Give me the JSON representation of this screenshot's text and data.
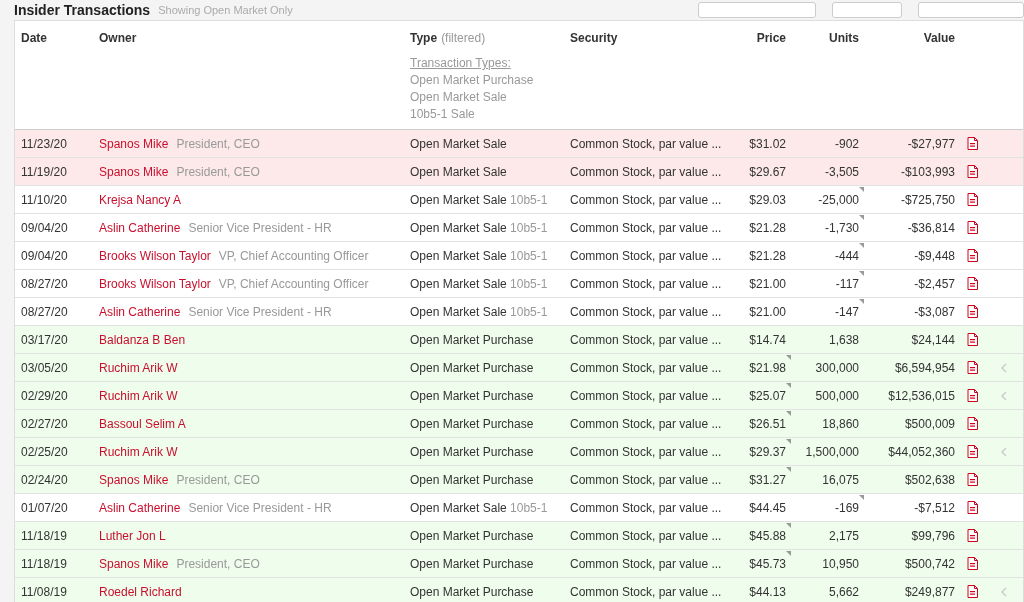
{
  "page": {
    "title": "Insider Transactions",
    "subtitle": "Showing Open Market Only"
  },
  "table": {
    "columns": [
      {
        "label": "Date"
      },
      {
        "label": "Owner"
      },
      {
        "label": "Type",
        "note": "(filtered)"
      },
      {
        "label": "Security"
      },
      {
        "label": "Price"
      },
      {
        "label": "Units"
      },
      {
        "label": "Value"
      }
    ],
    "filter": {
      "heading": "Transaction Types:",
      "options": [
        "Open Market Purchase",
        "Open Market Sale",
        "10b5-1 Sale"
      ]
    },
    "rows": [
      {
        "kind": "sale",
        "date": "11/23/20",
        "owner": "Spanos Mike",
        "role": "President, CEO",
        "type": "Open Market Sale",
        "security": "Common Stock, par value ...",
        "price": "$31.02",
        "units": "-902",
        "value": "-$27,977",
        "price_flag": false,
        "units_flag": false,
        "expander": false
      },
      {
        "kind": "sale",
        "date": "11/19/20",
        "owner": "Spanos Mike",
        "role": "President, CEO",
        "type": "Open Market Sale",
        "security": "Common Stock, par value ...",
        "price": "$29.67",
        "units": "-3,505",
        "value": "-$103,993",
        "price_flag": false,
        "units_flag": false,
        "expander": false
      },
      {
        "kind": "plan",
        "date": "11/10/20",
        "owner": "Krejsa Nancy A",
        "type": "Open Market Sale",
        "type_note": "10b5-1",
        "security": "Common Stock, par value ...",
        "price": "$29.03",
        "units": "-25,000",
        "value": "-$725,750",
        "price_flag": false,
        "units_flag": true,
        "expander": false
      },
      {
        "kind": "plan",
        "date": "09/04/20",
        "owner": "Aslin Catherine",
        "role": "Senior Vice President - HR",
        "type": "Open Market Sale",
        "type_note": "10b5-1",
        "security": "Common Stock, par value ...",
        "price": "$21.28",
        "units": "-1,730",
        "value": "-$36,814",
        "price_flag": false,
        "units_flag": true,
        "expander": false
      },
      {
        "kind": "plan",
        "date": "09/04/20",
        "owner": "Brooks Wilson Taylor",
        "role": "VP, Chief Accounting Officer",
        "type": "Open Market Sale",
        "type_note": "10b5-1",
        "security": "Common Stock, par value ...",
        "price": "$21.28",
        "units": "-444",
        "value": "-$9,448",
        "price_flag": false,
        "units_flag": true,
        "expander": false
      },
      {
        "kind": "plan",
        "date": "08/27/20",
        "owner": "Brooks Wilson Taylor",
        "role": "VP, Chief Accounting Officer",
        "type": "Open Market Sale",
        "type_note": "10b5-1",
        "security": "Common Stock, par value ...",
        "price": "$21.00",
        "units": "-117",
        "value": "-$2,457",
        "price_flag": false,
        "units_flag": true,
        "expander": false
      },
      {
        "kind": "plan",
        "date": "08/27/20",
        "owner": "Aslin Catherine",
        "role": "Senior Vice President - HR",
        "type": "Open Market Sale",
        "type_note": "10b5-1",
        "security": "Common Stock, par value ...",
        "price": "$21.00",
        "units": "-147",
        "value": "-$3,087",
        "price_flag": false,
        "units_flag": true,
        "expander": false
      },
      {
        "kind": "purchase",
        "date": "03/17/20",
        "owner": "Baldanza B Ben",
        "type": "Open Market Purchase",
        "security": "Common Stock, par value ...",
        "price": "$14.74",
        "units": "1,638",
        "value": "$24,144",
        "price_flag": false,
        "units_flag": false,
        "expander": false
      },
      {
        "kind": "purchase",
        "date": "03/05/20",
        "owner": "Ruchim Arik W",
        "type": "Open Market Purchase",
        "security": "Common Stock, par value ...",
        "price": "$21.98",
        "units": "300,000",
        "value": "$6,594,954",
        "price_flag": true,
        "units_flag": false,
        "expander": true
      },
      {
        "kind": "purchase",
        "date": "02/29/20",
        "owner": "Ruchim Arik W",
        "type": "Open Market Purchase",
        "security": "Common Stock, par value ...",
        "price": "$25.07",
        "units": "500,000",
        "value": "$12,536,015",
        "price_flag": true,
        "units_flag": false,
        "expander": true
      },
      {
        "kind": "purchase",
        "date": "02/27/20",
        "owner": "Bassoul Selim A",
        "type": "Open Market Purchase",
        "security": "Common Stock, par value ...",
        "price": "$26.51",
        "units": "18,860",
        "value": "$500,009",
        "price_flag": true,
        "units_flag": false,
        "expander": false
      },
      {
        "kind": "purchase",
        "date": "02/25/20",
        "owner": "Ruchim Arik W",
        "type": "Open Market Purchase",
        "security": "Common Stock, par value ...",
        "price": "$29.37",
        "units": "1,500,000",
        "value": "$44,052,360",
        "price_flag": true,
        "units_flag": false,
        "expander": true
      },
      {
        "kind": "purchase",
        "date": "02/24/20",
        "owner": "Spanos Mike",
        "role": "President, CEO",
        "type": "Open Market Purchase",
        "security": "Common Stock, par value ...",
        "price": "$31.27",
        "units": "16,075",
        "value": "$502,638",
        "price_flag": true,
        "units_flag": false,
        "expander": false
      },
      {
        "kind": "plan",
        "date": "01/07/20",
        "owner": "Aslin Catherine",
        "role": "Senior Vice President - HR",
        "type": "Open Market Sale",
        "type_note": "10b5-1",
        "security": "Common Stock, par value ...",
        "price": "$44.45",
        "units": "-169",
        "value": "-$7,512",
        "price_flag": false,
        "units_flag": true,
        "expander": false
      },
      {
        "kind": "purchase",
        "date": "11/18/19",
        "owner": "Luther Jon L",
        "type": "Open Market Purchase",
        "security": "Common Stock, par value ...",
        "price": "$45.88",
        "units": "2,175",
        "value": "$99,796",
        "price_flag": true,
        "units_flag": false,
        "expander": false
      },
      {
        "kind": "purchase",
        "date": "11/18/19",
        "owner": "Spanos Mike",
        "role": "President, CEO",
        "type": "Open Market Purchase",
        "security": "Common Stock, par value ...",
        "price": "$45.73",
        "units": "10,950",
        "value": "$500,742",
        "price_flag": true,
        "units_flag": false,
        "expander": false
      },
      {
        "kind": "purchase",
        "date": "11/08/19",
        "owner": "Roedel Richard",
        "type": "Open Market Purchase",
        "security": "Common Stock, par value ...",
        "price": "$44.13",
        "units": "5,662",
        "value": "$249,877",
        "price_flag": false,
        "units_flag": false,
        "expander": true
      }
    ]
  }
}
